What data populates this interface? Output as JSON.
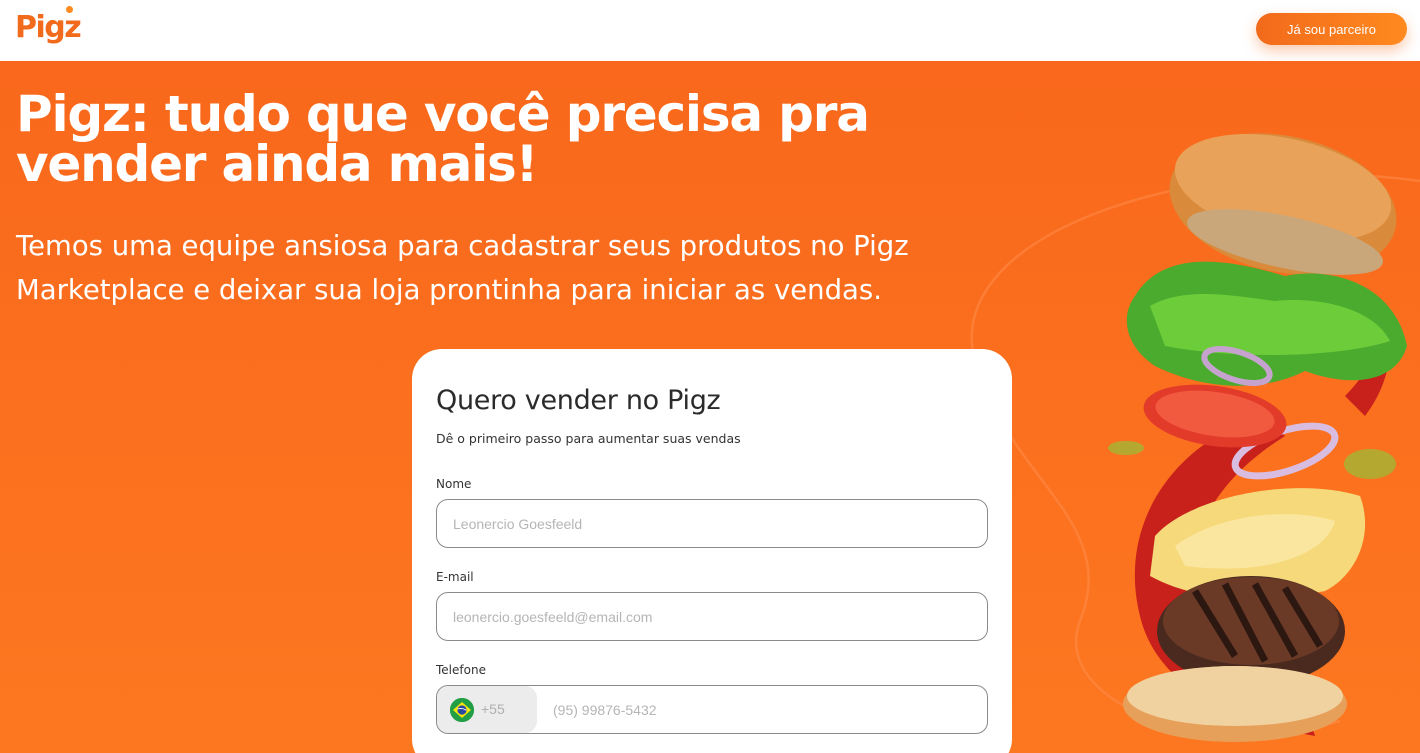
{
  "header": {
    "logo_text": "Pigz",
    "partner_button_label": "Já sou parceiro"
  },
  "hero": {
    "title": "Pigz: tudo que você precisa pra vender ainda mais!",
    "subtitle": "Temos uma equipe ansiosa para cadastrar seus produtos no Pigz Marketplace e deixar sua loja prontinha para iniciar as vendas.",
    "image": "burger-illustration"
  },
  "form": {
    "title": "Quero vender no Pigz",
    "subtitle": "Dê o primeiro passo para aumentar suas vendas",
    "fields": {
      "name": {
        "label": "Nome",
        "placeholder": "Leonercio Goesfeeld",
        "value": ""
      },
      "email": {
        "label": "E-mail",
        "placeholder": "leonercio.goesfeeld@email.com",
        "value": ""
      },
      "phone": {
        "label": "Telefone",
        "country_flag": "brazil-flag-icon",
        "country_code": "+55",
        "placeholder": "(95) 99876-5432",
        "value": ""
      }
    }
  },
  "colors": {
    "brand_orange": "#f26a1b",
    "brand_orange_light": "#ff8a1f",
    "hero_background": "#fa6d1e",
    "card_background": "#ffffff"
  }
}
